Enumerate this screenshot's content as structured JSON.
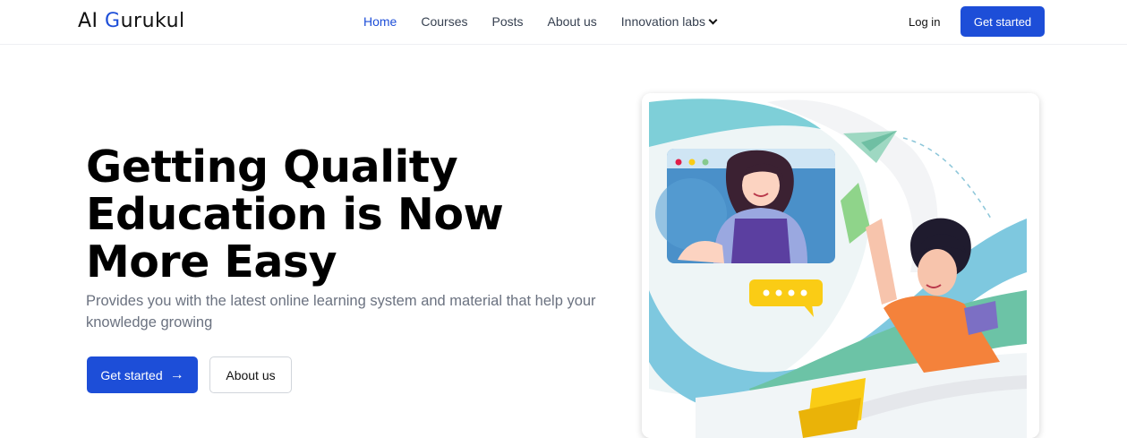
{
  "nav": {
    "logo_prefix": "AI ",
    "logo_g": "G",
    "logo_suffix": "urukul",
    "items": [
      {
        "label": "Home",
        "active": true
      },
      {
        "label": "Courses"
      },
      {
        "label": "Posts"
      },
      {
        "label": "About us"
      },
      {
        "label": "Innovation labs",
        "icon": "chevron-down-icon"
      }
    ],
    "login_label": "Log in",
    "cta_label": "Get started"
  },
  "hero": {
    "headline_line1": "Getting Quality",
    "headline_line2": "Education is Now",
    "headline_line3": "More Easy",
    "subtitle": "Provides you with the latest online learning system and material that help your knowledge growing",
    "primary_label": "Get started",
    "primary_icon": "arrow-right-icon",
    "secondary_label": "About us"
  },
  "colors": {
    "accent": "#1d4ed8",
    "text": "#000000",
    "muted": "#6b7280"
  }
}
